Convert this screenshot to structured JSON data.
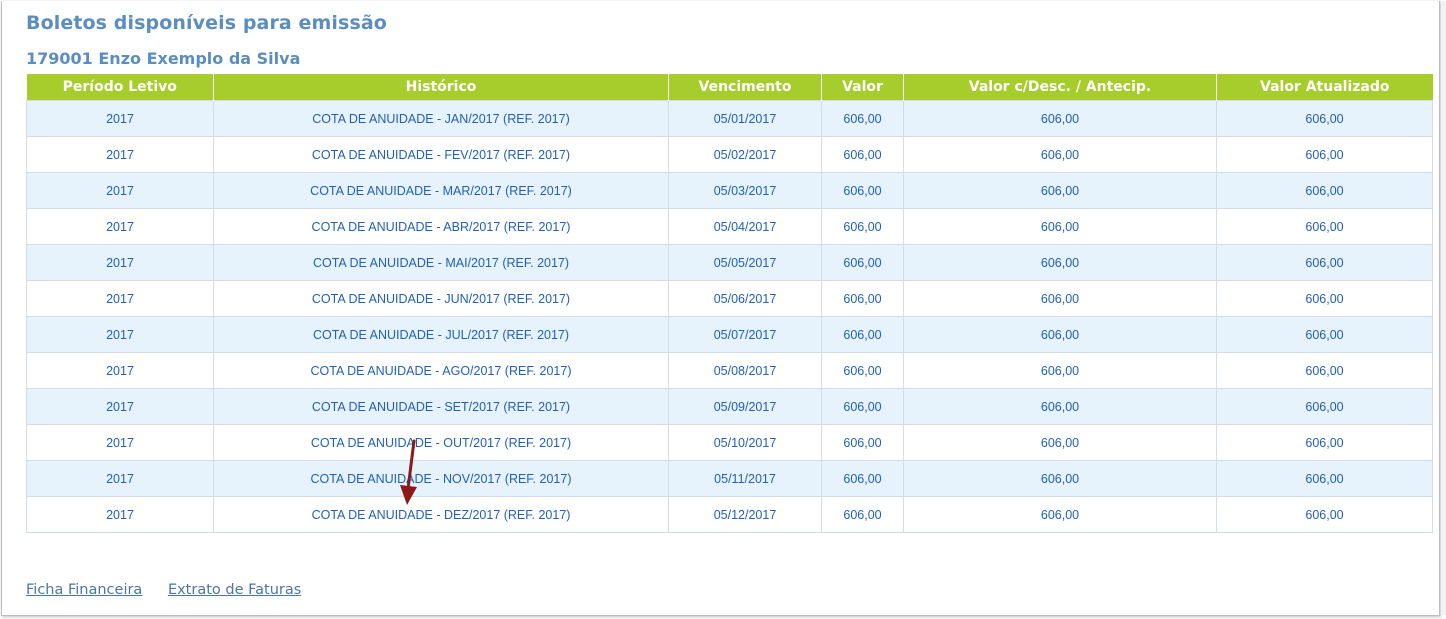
{
  "page": {
    "title": "Boletos disponíveis para emissão",
    "student": "179001 Enzo Exemplo da Silva"
  },
  "table": {
    "headers": [
      "Período Letivo",
      "Histórico",
      "Vencimento",
      "Valor",
      "Valor c/Desc. / Antecip.",
      "Valor Atualizado"
    ],
    "rows": [
      [
        "2017",
        "COTA DE ANUIDADE - JAN/2017 (REF. 2017)",
        "05/01/2017",
        "606,00",
        "606,00",
        "606,00"
      ],
      [
        "2017",
        "COTA DE ANUIDADE - FEV/2017 (REF. 2017)",
        "05/02/2017",
        "606,00",
        "606,00",
        "606,00"
      ],
      [
        "2017",
        "COTA DE ANUIDADE - MAR/2017 (REF. 2017)",
        "05/03/2017",
        "606,00",
        "606,00",
        "606,00"
      ],
      [
        "2017",
        "COTA DE ANUIDADE - ABR/2017 (REF. 2017)",
        "05/04/2017",
        "606,00",
        "606,00",
        "606,00"
      ],
      [
        "2017",
        "COTA DE ANUIDADE - MAI/2017 (REF. 2017)",
        "05/05/2017",
        "606,00",
        "606,00",
        "606,00"
      ],
      [
        "2017",
        "COTA DE ANUIDADE - JUN/2017 (REF. 2017)",
        "05/06/2017",
        "606,00",
        "606,00",
        "606,00"
      ],
      [
        "2017",
        "COTA DE ANUIDADE - JUL/2017 (REF. 2017)",
        "05/07/2017",
        "606,00",
        "606,00",
        "606,00"
      ],
      [
        "2017",
        "COTA DE ANUIDADE - AGO/2017 (REF. 2017)",
        "05/08/2017",
        "606,00",
        "606,00",
        "606,00"
      ],
      [
        "2017",
        "COTA DE ANUIDADE - SET/2017 (REF. 2017)",
        "05/09/2017",
        "606,00",
        "606,00",
        "606,00"
      ],
      [
        "2017",
        "COTA DE ANUIDADE - OUT/2017 (REF. 2017)",
        "05/10/2017",
        "606,00",
        "606,00",
        "606,00"
      ],
      [
        "2017",
        "COTA DE ANUIDADE - NOV/2017 (REF. 2017)",
        "05/11/2017",
        "606,00",
        "606,00",
        "606,00"
      ],
      [
        "2017",
        "COTA DE ANUIDADE - DEZ/2017 (REF. 2017)",
        "05/12/2017",
        "606,00",
        "606,00",
        "606,00"
      ]
    ]
  },
  "footer": {
    "ficha_label": "Ficha Financeira",
    "extrato_label": "Extrato de Faturas"
  },
  "colors": {
    "title": "#5b8dbf",
    "header_bg": "#a7cd2c",
    "row_alt_bg": "#e6f2fc",
    "cell_text": "#2160b8",
    "link": "#4a76a8",
    "arrow": "#8b1a1a"
  },
  "icons": {
    "annotation": "arrow-down-icon"
  }
}
